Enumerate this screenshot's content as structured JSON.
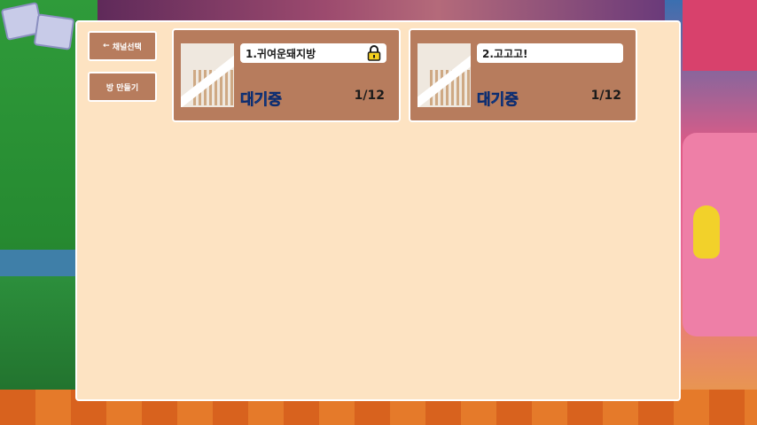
{
  "sidebar": {
    "channel_button": {
      "arrow": "←",
      "label": "채널선택"
    },
    "create_button": {
      "label": "방 만들기"
    }
  },
  "rooms": [
    {
      "title": "1.귀여운돼지방",
      "status": "대기중",
      "count": "1/12",
      "locked": true,
      "lock_icon": "padlock-icon"
    },
    {
      "title": "2.고고고!",
      "status": "대기중",
      "count": "1/12",
      "locked": false
    }
  ],
  "colors": {
    "panel_bg": "#fde3c2",
    "card_bg": "#b77c5d",
    "status_blue": "#1e74e4"
  }
}
